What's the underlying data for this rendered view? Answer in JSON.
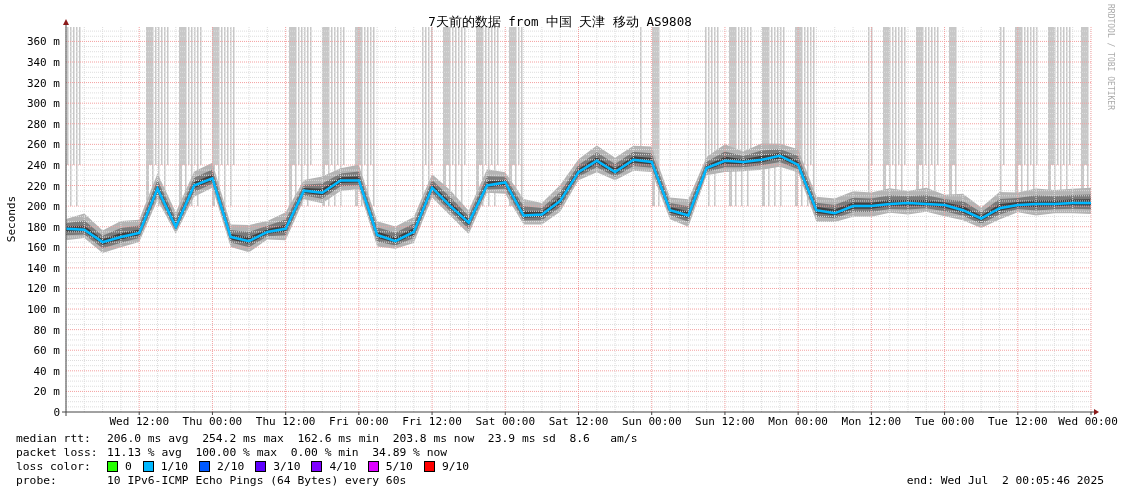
{
  "graph": {
    "chart_data": {
      "type": "line",
      "title": "7天前的数据 from 中国 天津 移动 AS9808",
      "ylabel": "Seconds",
      "categories": [
        null,
        null,
        null,
        null,
        "Wed 12:00",
        null,
        null,
        null,
        "Thu 00:00",
        null,
        null,
        null,
        "Thu 12:00",
        null,
        null,
        null,
        "Fri 00:00",
        null,
        null,
        null,
        "Fri 12:00",
        null,
        null,
        null,
        "Sat 00:00",
        null,
        null,
        null,
        "Sat 12:00",
        null,
        null,
        null,
        "Sun 00:00",
        null,
        null,
        null,
        "Sun 12:00",
        null,
        null,
        null,
        "Mon 00:00",
        null,
        null,
        null,
        "Mon 12:00",
        null,
        null,
        null,
        "Tue 00:00",
        null,
        null,
        null,
        "Tue 12:00",
        null,
        null,
        null,
        "Wed 00:00"
      ],
      "series": [
        {
          "color": "#00b8ff",
          "values": [
            178,
            177,
            165,
            170,
            174,
            217,
            180,
            220,
            227,
            170,
            166,
            175,
            178,
            215,
            213,
            225,
            225,
            172,
            166,
            175,
            218,
            200,
            184,
            220,
            223,
            191,
            192,
            205,
            233,
            244,
            233,
            245,
            243,
            196,
            191,
            237,
            244,
            243,
            245,
            249,
            240,
            196,
            193,
            200,
            200,
            202,
            203,
            202,
            201,
            196,
            188,
            198,
            201,
            202,
            202,
            203,
            203
          ]
        }
      ],
      "grid": true,
      "ylim": [
        0,
        374
      ],
      "yticks": [
        {
          "value": 0,
          "label": "0"
        },
        {
          "value": 20,
          "label": "20 m"
        },
        {
          "value": 40,
          "label": "40 m"
        },
        {
          "value": 60,
          "label": "60 m"
        },
        {
          "value": 80,
          "label": "80 m"
        },
        {
          "value": 100,
          "label": "100 m"
        },
        {
          "value": 120,
          "label": "120 m"
        },
        {
          "value": 140,
          "label": "140 m"
        },
        {
          "value": 160,
          "label": "160 m"
        },
        {
          "value": 180,
          "label": "180 m"
        },
        {
          "value": 200,
          "label": "200 m"
        },
        {
          "value": 220,
          "label": "220 m"
        },
        {
          "value": 240,
          "label": "240 m"
        },
        {
          "value": 260,
          "label": "260 m"
        },
        {
          "value": 280,
          "label": "280 m"
        },
        {
          "value": 300,
          "label": "300 m"
        },
        {
          "value": 320,
          "label": "320 m"
        },
        {
          "value": 340,
          "label": "340 m"
        },
        {
          "value": 360,
          "label": "360 m"
        }
      ]
    },
    "credit": "RRDTOOL / TOBI OETIKER"
  },
  "legend": {
    "rows": [
      {
        "kind": "stats",
        "label": "median rtt:",
        "text": "206.0 ms avg  254.2 ms max  162.6 ms min  203.8 ms now  23.9 ms sd  8.6   am/s"
      },
      {
        "kind": "stats",
        "label": "packet loss:",
        "text": "11.13 % avg  100.00 % max  0.00 % min  34.89 % now"
      },
      {
        "kind": "swatches",
        "label": "loss color:",
        "items": [
          {
            "label": "0",
            "color": "#26ff00"
          },
          {
            "label": "1/10",
            "color": "#00b8ff"
          },
          {
            "label": "2/10",
            "color": "#0059ff"
          },
          {
            "label": "3/10",
            "color": "#5e00ff"
          },
          {
            "label": "4/10",
            "color": "#7e00ff"
          },
          {
            "label": "5/10",
            "color": "#dd00ff"
          },
          {
            "label": "9/10",
            "color": "#ff0000"
          }
        ]
      },
      {
        "kind": "stats",
        "label": "probe:",
        "text": "10 IPv6-ICMP Echo Pings (64 Bytes) every 60s"
      }
    ],
    "end": "end: Wed Jul  2 00:05:46 2025"
  }
}
